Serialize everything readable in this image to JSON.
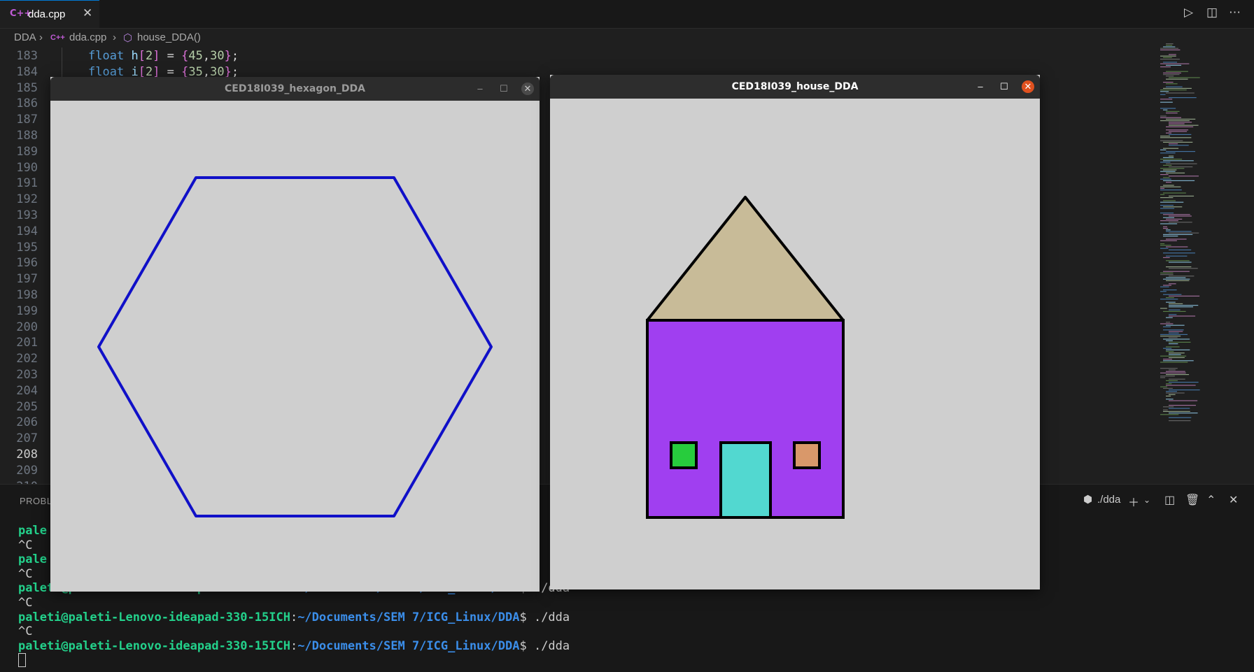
{
  "editor": {
    "tab": {
      "icon": "cpp-file-icon",
      "glyph": "C++",
      "label": "dda.cpp"
    },
    "breadcrumb": {
      "folder": "DDA",
      "file": "dda.cpp",
      "symbol": "house_DDA()",
      "separator": "›"
    },
    "line_numbers": [
      "183",
      "184",
      "185",
      "186",
      "187",
      "188",
      "189",
      "190",
      "191",
      "192",
      "193",
      "194",
      "195",
      "196",
      "197",
      "198",
      "199",
      "200",
      "201",
      "202",
      "203",
      "204",
      "205",
      "206",
      "207",
      "208",
      "209",
      "210"
    ],
    "active_line": "208",
    "code_lines": [
      {
        "type": "float",
        "var": "h",
        "idx": "2",
        "a": "45",
        "b": "30"
      },
      {
        "type": "float",
        "var": "i",
        "idx": "2",
        "a": "35",
        "b": "30"
      }
    ]
  },
  "toolbar": {
    "run": "▷",
    "split": "◫",
    "more": "⋯"
  },
  "panel": {
    "tab_label": "PROBL",
    "terminal_name": "./dda",
    "icons": [
      "terminal-icon",
      "add-icon",
      "chevron-down-icon",
      "split-icon",
      "trash-icon",
      "chevron-up-icon",
      "close-icon"
    ]
  },
  "terminal": {
    "user": "paleti@paleti-Lenovo-ideapad-330-15ICH",
    "path": "~/Documents/SEM 7/ICG_Linux/DDA",
    "prompt_sym": "$",
    "command": " ./dda",
    "interrupt": "^C",
    "partial_suffix": "da",
    "partial_user": "pale",
    "partial_prompt_text": "paleti@paleti-Lenovo-ideapad-330-15ICH:~/Documents/SEM 7/ICG_Linux/DDA$ ./dda"
  },
  "windows": {
    "hexagon": {
      "title": "CED18I039_hexagon_DDA",
      "minimize": "–",
      "maximize": "☐",
      "close": "✕",
      "line_color": "#1010c8",
      "background": "#cfcfcf"
    },
    "house": {
      "title": "CED18I039_house_DDA",
      "minimize": "–",
      "maximize": "☐",
      "close": "✕",
      "colors": {
        "roof": "#c8bb98",
        "wall": "#a03ff0",
        "door": "#52d8d0",
        "left_window": "#27cc3d",
        "right_window": "#d9986a",
        "outline": "#000000"
      }
    }
  }
}
